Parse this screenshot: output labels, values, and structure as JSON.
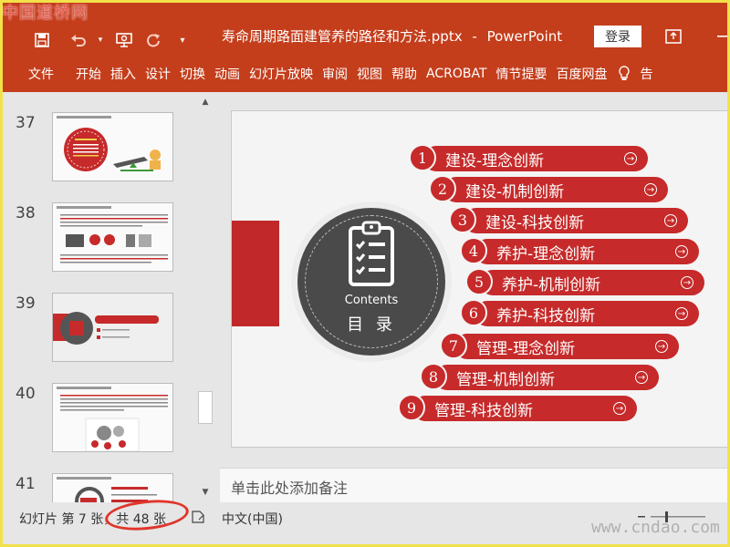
{
  "watermark_top": "中国道桥网",
  "watermark_bottom": "www.cndao.com",
  "titlebar": {
    "document_title": "寿命周期路面建管养的路径和方法.pptx",
    "separator": "-",
    "app_name": "PowerPoint",
    "login_label": "登录",
    "icons": [
      "save-icon",
      "undo-icon",
      "presenter-icon",
      "redo-icon",
      "customize-qat-icon",
      "ribbon-display-icon",
      "minimize-icon"
    ]
  },
  "ribbon": {
    "tabs": [
      "文件",
      "开始",
      "插入",
      "设计",
      "切换",
      "动画",
      "幻灯片放映",
      "审阅",
      "视图",
      "帮助",
      "ACROBAT",
      "情节提要",
      "百度网盘",
      "告"
    ]
  },
  "thumbnails": [
    {
      "number": "37"
    },
    {
      "number": "38"
    },
    {
      "number": "39"
    },
    {
      "number": "40"
    },
    {
      "number": "41"
    }
  ],
  "slide": {
    "contents_en": "Contents",
    "contents_zh": "目 录",
    "items": [
      {
        "num": "1",
        "label": "建设-理念创新"
      },
      {
        "num": "2",
        "label": "建设-机制创新"
      },
      {
        "num": "3",
        "label": "建设-科技创新"
      },
      {
        "num": "4",
        "label": "养护-理念创新"
      },
      {
        "num": "5",
        "label": "养护-机制创新"
      },
      {
        "num": "6",
        "label": "养护-科技创新"
      },
      {
        "num": "7",
        "label": "管理-理念创新"
      },
      {
        "num": "8",
        "label": "管理-机制创新"
      },
      {
        "num": "9",
        "label": "管理-科技创新"
      }
    ]
  },
  "notes_placeholder": "单击此处添加备注",
  "statusbar": {
    "slide_info": "幻灯片 第 7 张，共 48 张",
    "language": "中文(中国)"
  },
  "colors": {
    "ribbon": "#c43e1c",
    "accent_red": "#c62a2a",
    "highlight_circle": "#e0352b"
  }
}
